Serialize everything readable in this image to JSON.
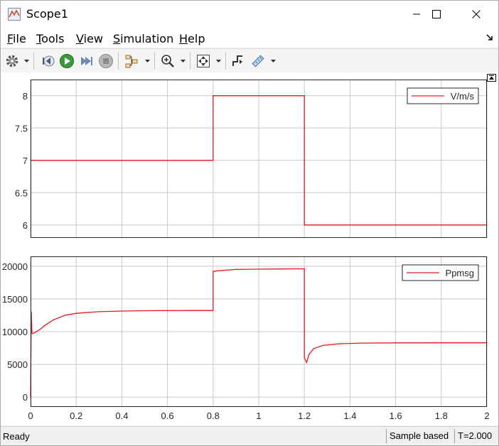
{
  "window": {
    "title": "Scope1",
    "controls": {
      "minimize": "minimize-icon",
      "maximize": "maximize-icon",
      "close": "close-icon"
    }
  },
  "menu": [
    {
      "accel": "F",
      "rest": "ile"
    },
    {
      "accel": "T",
      "rest": "ools"
    },
    {
      "accel": "V",
      "rest": "iew"
    },
    {
      "accel": "S",
      "rest": "imulation"
    },
    {
      "accel": "H",
      "rest": "elp"
    }
  ],
  "toolbar": {
    "icons": [
      "gear-icon",
      "step-back-icon",
      "run-icon",
      "step-forward-icon",
      "stop-icon",
      "signal-selector-icon",
      "zoom-icon",
      "autoscale-icon",
      "triggers-icon",
      "measurements-icon"
    ]
  },
  "colors": {
    "signal": "#e41a1c",
    "axis": "#262626",
    "grid": "#c8c8c8"
  },
  "chart_data": [
    {
      "type": "line",
      "ylim": [
        5.8,
        8.25
      ],
      "xlim": [
        0,
        2
      ],
      "grid": true,
      "legend_position": "top-right",
      "yticks": [
        "8",
        "7.5",
        "7",
        "6.5",
        "6"
      ],
      "ytick_values": [
        8,
        7.5,
        7,
        6.5,
        6
      ],
      "series": [
        {
          "name": "V/m/s",
          "color": "#e41a1c",
          "x": [
            0,
            0.8,
            0.8,
            1.2,
            1.2,
            2.0
          ],
          "y": [
            7,
            7,
            8,
            8,
            6,
            6
          ]
        }
      ]
    },
    {
      "type": "line",
      "ylim": [
        -1500,
        21500
      ],
      "xlim": [
        0,
        2
      ],
      "grid": true,
      "legend_position": "top-right",
      "xticks": [
        "0",
        "0.2",
        "0.4",
        "0.6",
        "0.8",
        "1",
        "1.2",
        "1.4",
        "1.6",
        "1.8",
        "2"
      ],
      "xtick_values": [
        0,
        0.2,
        0.4,
        0.6,
        0.8,
        1,
        1.2,
        1.4,
        1.6,
        1.8,
        2
      ],
      "yticks": [
        "20000",
        "15000",
        "10000",
        "5000",
        "0"
      ],
      "ytick_values": [
        20000,
        15000,
        10000,
        5000,
        0
      ],
      "series": [
        {
          "name": "Ppmsg",
          "color": "#e41a1c",
          "x": [
            0,
            0.003,
            0.006,
            0.01,
            0.02,
            0.04,
            0.06,
            0.1,
            0.15,
            0.2,
            0.3,
            0.4,
            0.5,
            0.6,
            0.7,
            0.8,
            0.8,
            0.82,
            0.9,
            1.0,
            1.1,
            1.2,
            1.2,
            1.21,
            1.22,
            1.24,
            1.28,
            1.35,
            1.45,
            1.6,
            1.8,
            2.0
          ],
          "y": [
            0,
            13000,
            9800,
            9700,
            9900,
            10300,
            10900,
            11800,
            12500,
            12800,
            13050,
            13150,
            13200,
            13220,
            13230,
            13230,
            19200,
            19300,
            19500,
            19550,
            19580,
            19600,
            6000,
            5300,
            6500,
            7400,
            7900,
            8150,
            8250,
            8290,
            8300,
            8300
          ]
        }
      ]
    }
  ],
  "status": {
    "ready": "Ready",
    "mode": "Sample based",
    "time": "T=2.000"
  }
}
